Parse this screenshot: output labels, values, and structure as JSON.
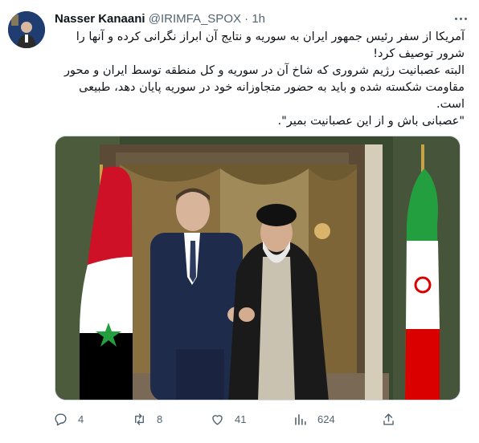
{
  "tweet": {
    "author": {
      "display_name": "Nasser Kanaani",
      "handle": "@IRIMFA_SPOX",
      "separator": "·",
      "time": "1h"
    },
    "body_lines": [
      "آمریکا از سفر رئیس جمهور ایران به سوریه و نتایج آن ابراز نگرانی کرده و آنها را شرور توصیف کرد!",
      "البته عصبانیت رژیم شرورى که شاخ آن در سوریه و کل منطقه توسط ایران و محور مقاومت شکسته شده و باید به حضور متجاوزانه خود در سوریه پایان دهد، طبیعی است.",
      "\"عصبانی باش و از این عصبانیت بمیر\"."
    ],
    "media": {
      "icon": "photo",
      "colors": {
        "flag_red": "#ce1126",
        "flag_green": "#239f40",
        "suit": "#1f2b4a",
        "robe": "#1a1a1a",
        "curtain": "#8a7040"
      }
    },
    "actions": {
      "reply_count": "4",
      "retweet_count": "8",
      "like_count": "41",
      "views_count": "624"
    }
  }
}
